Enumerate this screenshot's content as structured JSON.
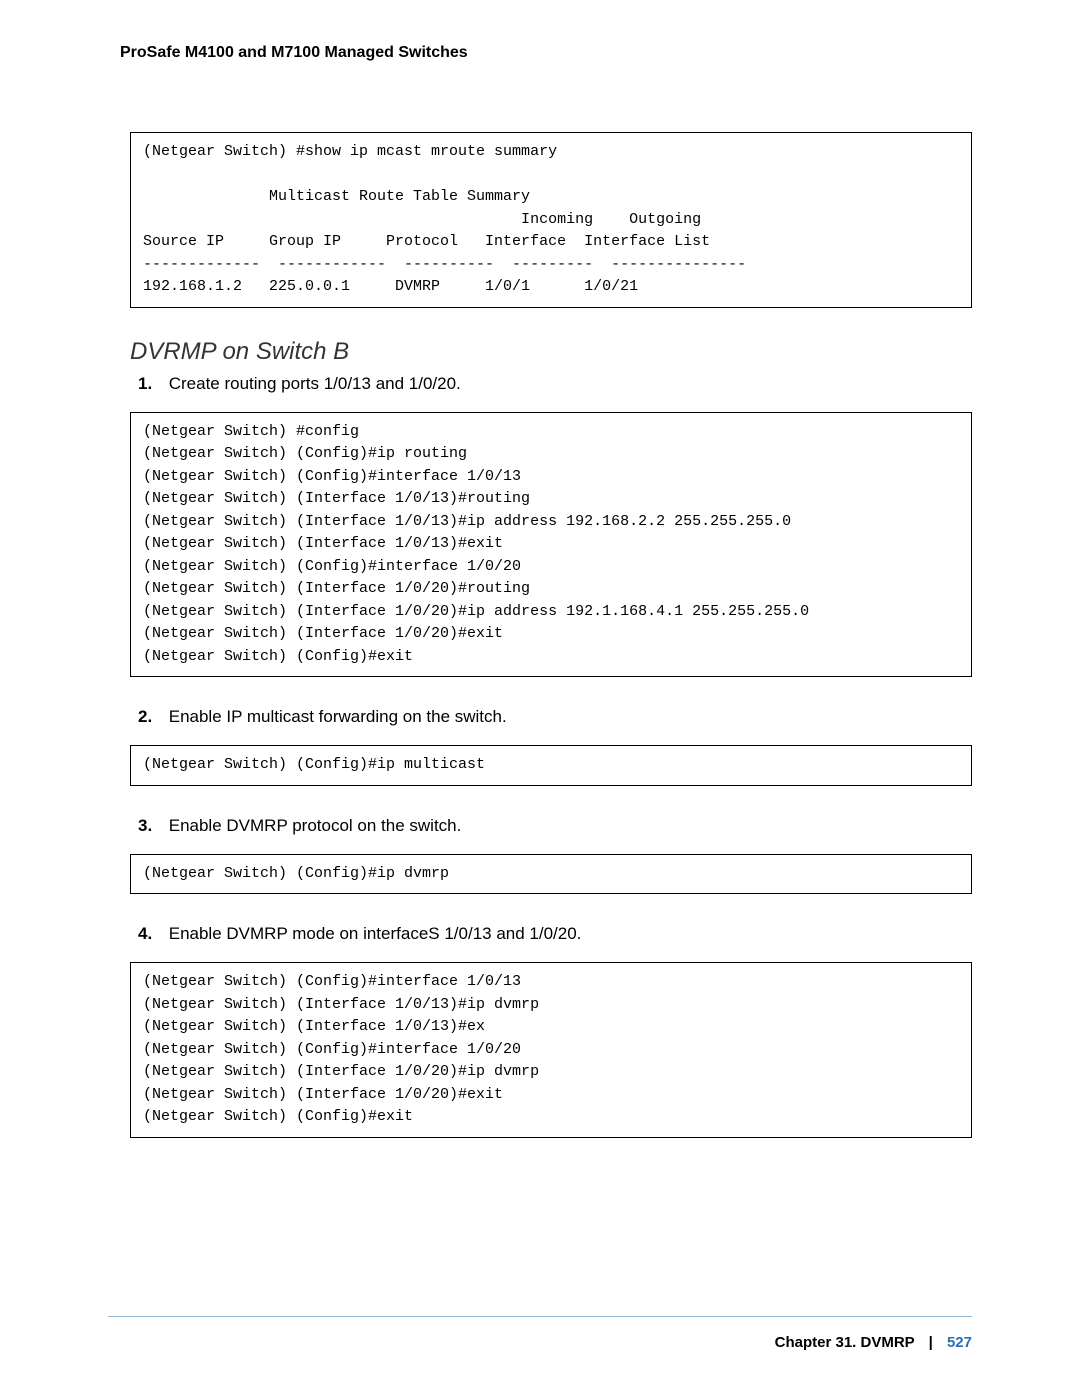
{
  "header": {
    "running_head": "ProSafe M4100 and M7100 Managed Switches"
  },
  "code1": "(Netgear Switch) #show ip mcast mroute summary\n\n              Multicast Route Table Summary\n                                          Incoming    Outgoing\nSource IP     Group IP     Protocol   Interface  Interface List\n-------------  ------------  ----------  ---------  ---------------\n192.168.1.2   225.0.0.1     DVMRP     1/0/1      1/0/21",
  "section_title": "DVRMP on Switch B",
  "steps": {
    "s1": {
      "num": "1.",
      "text": "Create routing ports 1/0/13 and 1/0/20."
    },
    "s2": {
      "num": "2.",
      "text": "Enable IP multicast forwarding on the switch."
    },
    "s3": {
      "num": "3.",
      "text": "Enable DVMRP protocol on the switch."
    },
    "s4": {
      "num": "4.",
      "text": "Enable DVMRP mode on interfaceS 1/0/13 and 1/0/20."
    }
  },
  "code2": "(Netgear Switch) #config\n(Netgear Switch) (Config)#ip routing\n(Netgear Switch) (Config)#interface 1/0/13\n(Netgear Switch) (Interface 1/0/13)#routing\n(Netgear Switch) (Interface 1/0/13)#ip address 192.168.2.2 255.255.255.0\n(Netgear Switch) (Interface 1/0/13)#exit\n(Netgear Switch) (Config)#interface 1/0/20\n(Netgear Switch) (Interface 1/0/20)#routing\n(Netgear Switch) (Interface 1/0/20)#ip address 192.1.168.4.1 255.255.255.0\n(Netgear Switch) (Interface 1/0/20)#exit\n(Netgear Switch) (Config)#exit",
  "code3": "(Netgear Switch) (Config)#ip multicast",
  "code4": "(Netgear Switch) (Config)#ip dvmrp",
  "code5": "(Netgear Switch) (Config)#interface 1/0/13\n(Netgear Switch) (Interface 1/0/13)#ip dvmrp\n(Netgear Switch) (Interface 1/0/13)#ex\n(Netgear Switch) (Config)#interface 1/0/20\n(Netgear Switch) (Interface 1/0/20)#ip dvmrp\n(Netgear Switch) (Interface 1/0/20)#exit\n(Netgear Switch) (Config)#exit",
  "footer": {
    "chapter": "Chapter 31.  DVMRP",
    "sep": "|",
    "page": "527"
  }
}
